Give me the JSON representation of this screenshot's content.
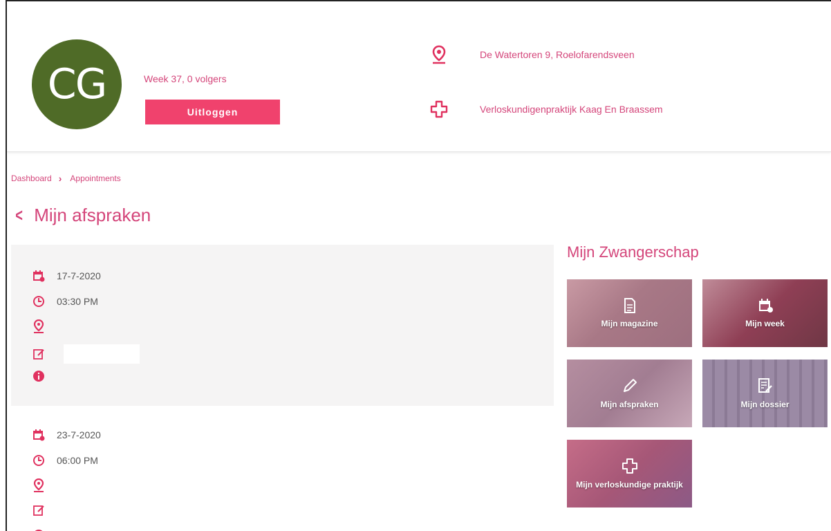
{
  "profile": {
    "initials": "CG",
    "avatar_color": "#4f6b27",
    "week_text": "Week 37, 0 volgers",
    "logout_label": "Uitloggen"
  },
  "info": {
    "address": "De Watertoren 9, Roelofarendsveen",
    "address_icon": "location-pin-icon",
    "practice": "Verloskundigenpraktijk Kaag En Braassem",
    "practice_icon": "medical-cross-icon"
  },
  "breadcrumb": {
    "items": [
      "Dashboard",
      "Appointments"
    ]
  },
  "page": {
    "title": "Mijn afspraken"
  },
  "appointments": [
    {
      "date": "17-7-2020",
      "time": "03:30 PM",
      "location": "",
      "note": "",
      "info": ""
    },
    {
      "date": "23-7-2020",
      "time": "06:00 PM",
      "location": "",
      "note": "",
      "info": ""
    }
  ],
  "sidebar": {
    "title": "Mijn Zwangerschap",
    "tiles": [
      {
        "label": "Mijn magazine",
        "icon": "document-icon"
      },
      {
        "label": "Mijn week",
        "icon": "calendar-icon"
      },
      {
        "label": "Mijn afspraken",
        "icon": "pencil-icon"
      },
      {
        "label": "Mijn dossier",
        "icon": "file-edit-icon"
      },
      {
        "label": "Mijn verloskundige praktijk",
        "icon": "medical-cross-icon"
      }
    ]
  },
  "colors": {
    "accent": "#d4457a",
    "button": "#f0426d"
  }
}
